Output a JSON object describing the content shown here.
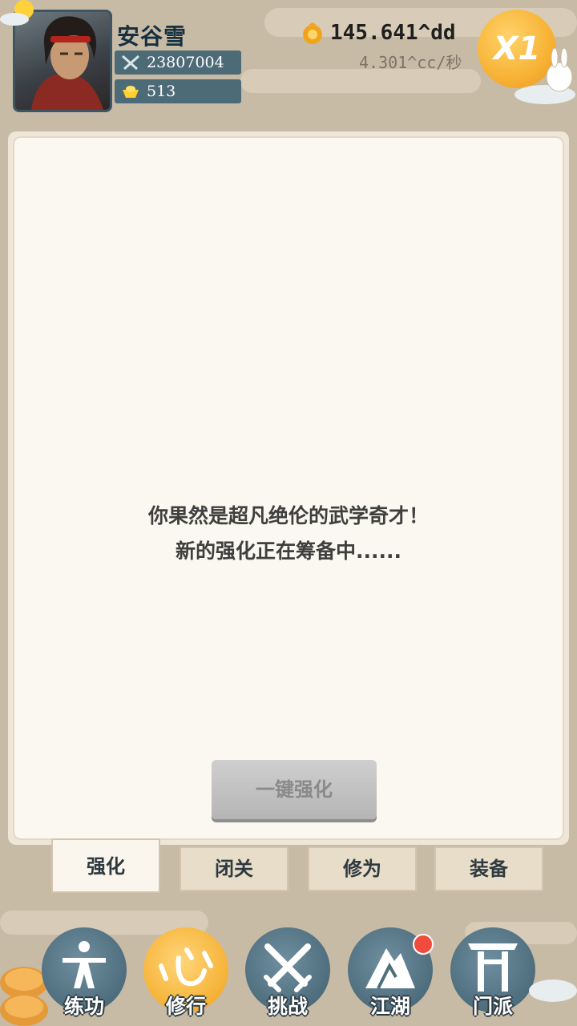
{
  "player": {
    "name": "安谷雪",
    "power": "23807004",
    "ingots": "513"
  },
  "currency": {
    "gold": "145.641^dd",
    "rate": "4.301^cc/秒"
  },
  "speed": {
    "label": "X1"
  },
  "panel": {
    "message_line1": "你果然是超凡绝伦的武学奇才！",
    "message_line2": "新的强化正在筹备中......",
    "enhance_button": "一键强化"
  },
  "tabs": [
    {
      "label": "强化",
      "active": true
    },
    {
      "label": "闭关",
      "active": false
    },
    {
      "label": "修为",
      "active": false
    },
    {
      "label": "装备",
      "active": false
    }
  ],
  "nav": [
    {
      "label": "练功",
      "icon": "kungfu-figure-icon",
      "active": false
    },
    {
      "label": "修行",
      "icon": "heart-glyph-icon",
      "active": true
    },
    {
      "label": "挑战",
      "icon": "crossed-swords-icon",
      "active": false
    },
    {
      "label": "江湖",
      "icon": "mountain-icon",
      "active": false,
      "badge": true
    },
    {
      "label": "门派",
      "icon": "gate-icon",
      "active": false
    }
  ],
  "colors": {
    "background": "#c8bba6",
    "panel": "#fbf8f1",
    "accent_gold": "#f6b43a",
    "nav_blue": "#4e6d7d",
    "stat_pill": "#4d6a77",
    "badge_red": "#f04b3b"
  }
}
